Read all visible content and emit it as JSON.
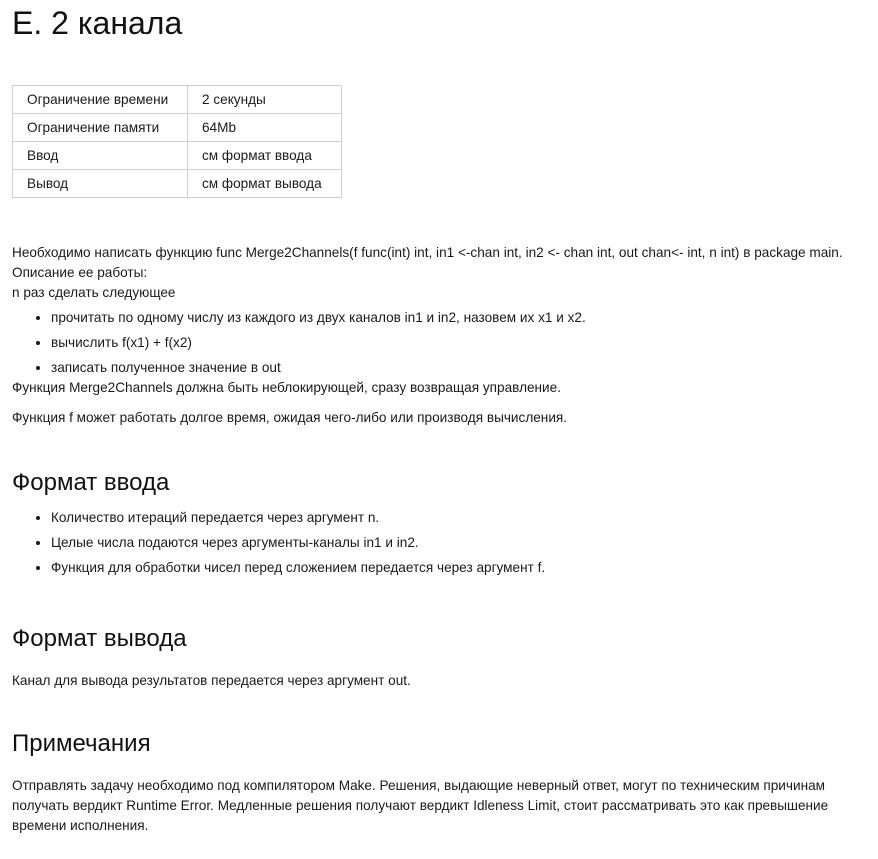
{
  "title": "E. 2 канала",
  "limits": [
    {
      "key": "Ограничение времени",
      "value": "2 секунды"
    },
    {
      "key": "Ограничение памяти",
      "value": "64Mb"
    },
    {
      "key": "Ввод",
      "value": "см формат ввода"
    },
    {
      "key": "Вывод",
      "value": "см формат вывода"
    }
  ],
  "statement": {
    "line1": "Необходимо написать функцию func Merge2Channels(f func(int) int, in1 <-chan int, in2 <- chan int, out chan<- int, n int) в package main.",
    "line2": "Описание ее работы:",
    "line3": "n раз сделать следующее",
    "steps": [
      "прочитать по одному числу из каждого из двух каналов in1 и in2, назовем их x1 и x2.",
      "вычислить f(x1) + f(x2)",
      "записать полученное значение в out"
    ],
    "nonblocking": "Функция Merge2Channels должна быть неблокирующей, сразу возвращая управление.",
    "long_running": "Функция f может работать долгое время, ожидая чего-либо или производя вычисления."
  },
  "input_format": {
    "heading": "Формат ввода",
    "items": [
      "Количество итераций передается через аргумент n.",
      "Целые числа подаются через аргументы-каналы in1 и in2.",
      "Функция для обработки чисел перед сложением передается через аргумент f."
    ]
  },
  "output_format": {
    "heading": "Формат вывода",
    "text": "Канал для вывода результатов передается через аргумент out."
  },
  "notes": {
    "heading": "Примечания",
    "text": "Отправлять задачу необходимо под компилятором Make. Решения, выдающие неверный ответ, могут по техническим причинам получать вердикт Runtime Error. Медленные решения получают вердикт Idleness Limit, стоит рассматривать это как превышение времени исполнения."
  }
}
